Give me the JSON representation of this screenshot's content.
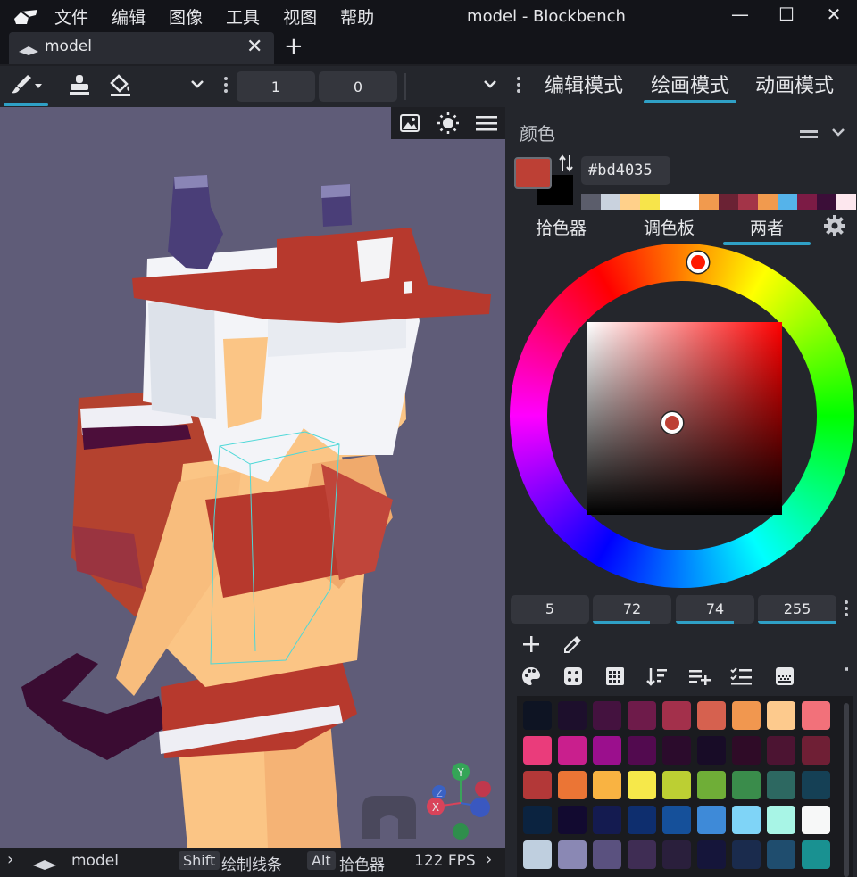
{
  "window": {
    "title": "model - Blockbench",
    "menu": [
      "文件",
      "编辑",
      "图像",
      "工具",
      "视图",
      "帮助"
    ]
  },
  "tabs": [
    {
      "label": "model"
    }
  ],
  "toolbar": {
    "field_1": "1",
    "field_2": "0"
  },
  "modes": [
    "编辑模式",
    "绘画模式",
    "动画模式"
  ],
  "panel": {
    "title": "颜色",
    "hex": "#bd4035",
    "main_color": "#bd4035",
    "secondary_color": "#000000",
    "history": [
      "#5b5d6b",
      "#c9d2de",
      "#ffd08a",
      "#f7e44a",
      "#ffffff",
      "#ffffff",
      "#f19a4e",
      "#6b2234",
      "#a33448",
      "#f19a4e",
      "#55b3ea",
      "#7c1b45",
      "#3b0e38",
      "#fde7ee"
    ],
    "subtabs": [
      "拾色器",
      "调色板",
      "两者"
    ],
    "values": [
      "5",
      "72",
      "74",
      "255"
    ]
  },
  "palette": [
    [
      "#0e1423",
      "#1d0f2c",
      "#44123f",
      "#6e1b4a",
      "#a3304b",
      "#d6614f",
      "#f1974f",
      "#fdca8d",
      "#f2717a"
    ],
    [
      "#ea3c7b",
      "#c91f8d",
      "#9b0f8d",
      "#520a4f",
      "#2b0b2c",
      "#180c27",
      "#2f0b27",
      "#4c1432",
      "#6f1f35"
    ],
    [
      "#b33838",
      "#eb7535",
      "#f9b342",
      "#f6e84a",
      "#bccf33",
      "#6fae37",
      "#3a8c4b",
      "#2d6861",
      "#154055"
    ],
    [
      "#0b2340",
      "#120a30",
      "#141b50",
      "#0e2e6e",
      "#15509a",
      "#3e8ad8",
      "#7fd4f7",
      "#a8f5e6",
      "#f7f8f8"
    ],
    [
      "#bfcfdf",
      "#8a88b4",
      "#5a517f",
      "#3f2d54",
      "#2a1f3c",
      "#15153a",
      "#1a2b4d",
      "#1f4d6e",
      "#199191"
    ]
  ],
  "status": {
    "model": "model",
    "key1": "Shift",
    "hint1": "绘制线条",
    "key2": "Alt",
    "hint2": "拾色器",
    "fps": "122 FPS"
  }
}
